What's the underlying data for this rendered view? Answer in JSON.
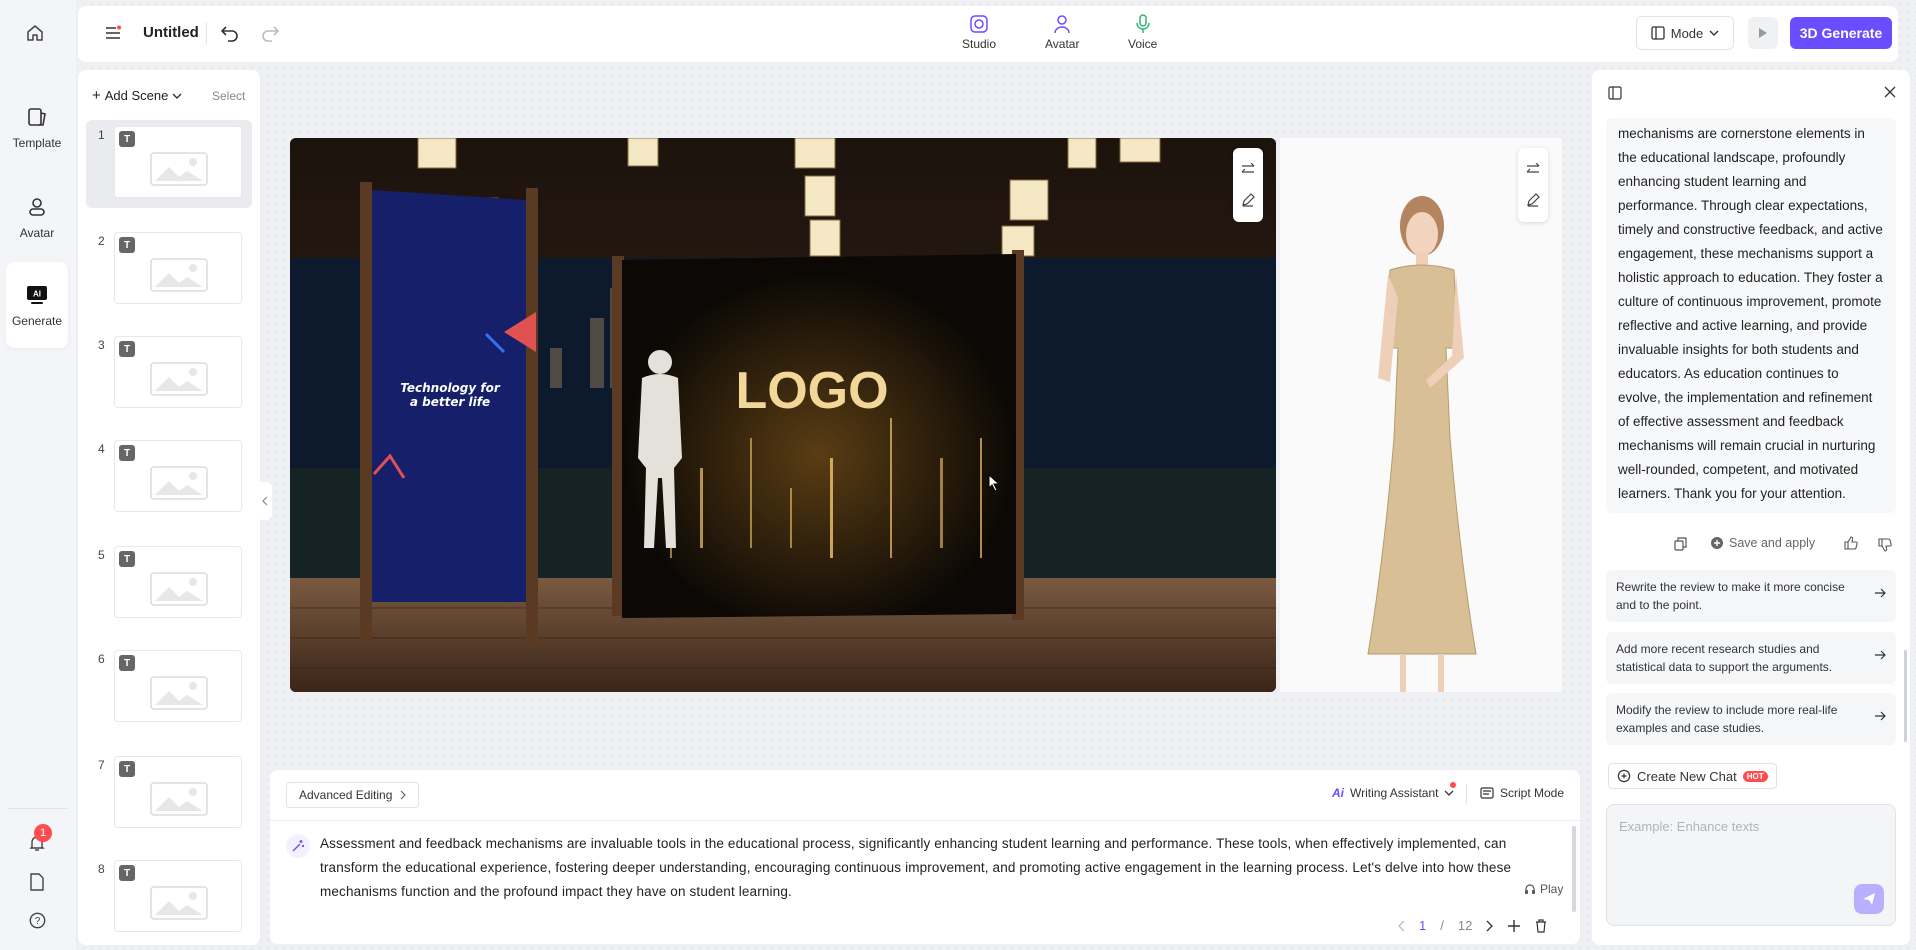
{
  "rail": {
    "items": [
      {
        "label": "Template",
        "icon": "template-icon"
      },
      {
        "label": "Avatar",
        "icon": "avatar-icon"
      },
      {
        "label": "Generate",
        "icon": "ai-generate-icon"
      }
    ],
    "notification_count": "1"
  },
  "topbar": {
    "title": "Untitled",
    "tools": [
      {
        "label": "Studio",
        "icon": "studio-icon"
      },
      {
        "label": "Avatar",
        "icon": "avatar-icon"
      },
      {
        "label": "Voice",
        "icon": "microphone-icon"
      }
    ],
    "mode_label": "Mode",
    "generate_label": "3D Generate"
  },
  "scenes": {
    "add_label": "Add Scene",
    "select_label": "Select",
    "items": [
      "1",
      "2",
      "3",
      "4",
      "5",
      "6",
      "7",
      "8"
    ],
    "badge": "T"
  },
  "stage": {
    "banner_text_line1": "Technology for",
    "banner_text_line2": "a better life",
    "screen_logo": "LOGO"
  },
  "script": {
    "advanced_editing": "Advanced Editing",
    "writing_assistant": "Writing Assistant",
    "script_mode": "Script Mode",
    "text": "Assessment and feedback mechanisms are invaluable tools in the educational process, significantly enhancing student learning and performance. These tools, when effectively implemented, can transform the educational experience, fostering deeper understanding, encouraging continuous improvement, and promoting active engagement in the learning process. Let's delve into how these mechanisms function and the profound impact they have on student learning.",
    "play_label": "Play",
    "page_current": "1",
    "page_sep": "/",
    "page_total": "12"
  },
  "assistant": {
    "response": "mechanisms are cornerstone elements in the educational landscape, profoundly enhancing student learning and performance. Through clear expectations, timely and constructive feedback, and active engagement, these mechanisms support a holistic approach to education. They foster a culture of continuous improvement, promote reflective and active learning, and provide invaluable insights for both students and educators. As education continues to evolve, the implementation and refinement of effective assessment and feedback mechanisms will remain crucial in nurturing well-rounded, competent, and motivated learners. Thank you for your attention.",
    "save_apply": "Save and apply",
    "suggestions": [
      "Rewrite the review to make it more concise and to the point.",
      "Add more recent research studies and statistical data to support the arguments.",
      "Modify the review to include more real-life examples and case studies."
    ],
    "new_chat": "Create New Chat",
    "hot_badge": "HOT",
    "input_placeholder": "Example: Enhance texts"
  },
  "colors": {
    "accent": "#6a4dff",
    "notification": "#ff4d4f"
  }
}
